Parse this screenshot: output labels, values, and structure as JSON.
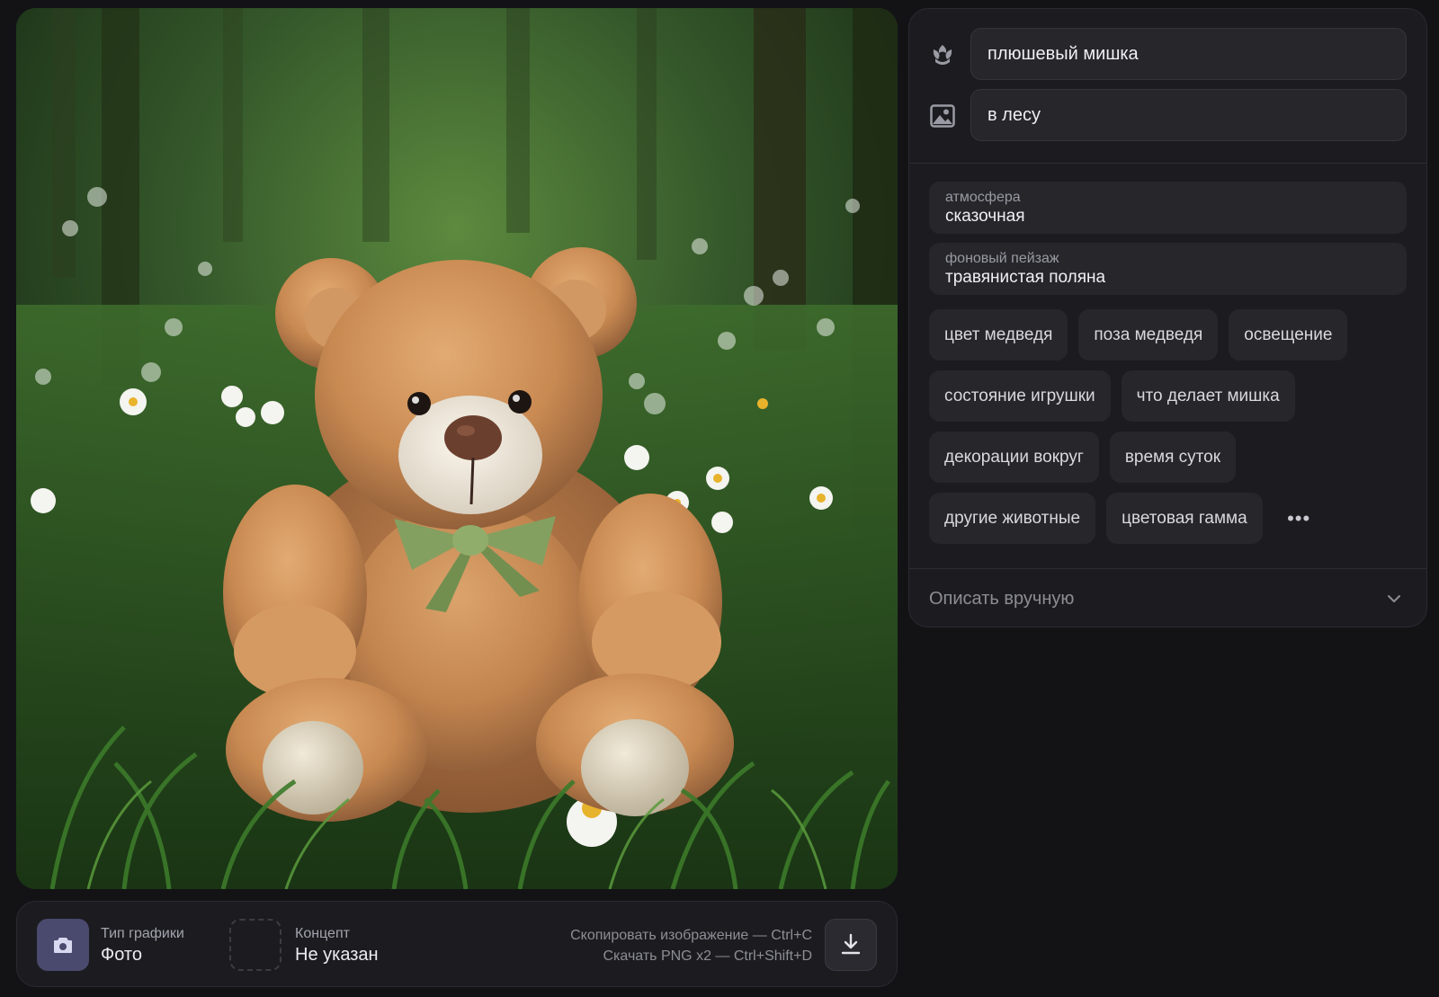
{
  "image": {
    "alt": "плюшевый мишка в лесу"
  },
  "prompt": {
    "subject": "плюшевый мишка",
    "setting": "в лесу"
  },
  "attributes": [
    {
      "label": "атмосфера",
      "value": "сказочная"
    },
    {
      "label": "фоновый пейзаж",
      "value": "травянистая поляна"
    }
  ],
  "chips": [
    "цвет медведя",
    "поза медведя",
    "освещение",
    "состояние игрушки",
    "что делает мишка",
    "декорации вокруг",
    "время суток",
    "другие животные",
    "цветовая гамма"
  ],
  "more_label": "•••",
  "manual": {
    "label": "Описать вручную"
  },
  "bottom": {
    "type_label": "Тип графики",
    "type_value": "Фото",
    "concept_label": "Концепт",
    "concept_value": "Не указан",
    "copy_hint": "Скопировать изображение — Ctrl+C",
    "download_hint": "Скачать PNG x2 — Ctrl+Shift+D"
  },
  "colors": {
    "accent_tile": "#4a4a6e",
    "background": "#131316",
    "panel": "#1c1c20"
  },
  "icons": {
    "subject": "flower-bud-icon",
    "setting": "image-landscape-icon",
    "type": "camera-icon",
    "download": "download-icon",
    "manual": "chevron-down-icon"
  }
}
